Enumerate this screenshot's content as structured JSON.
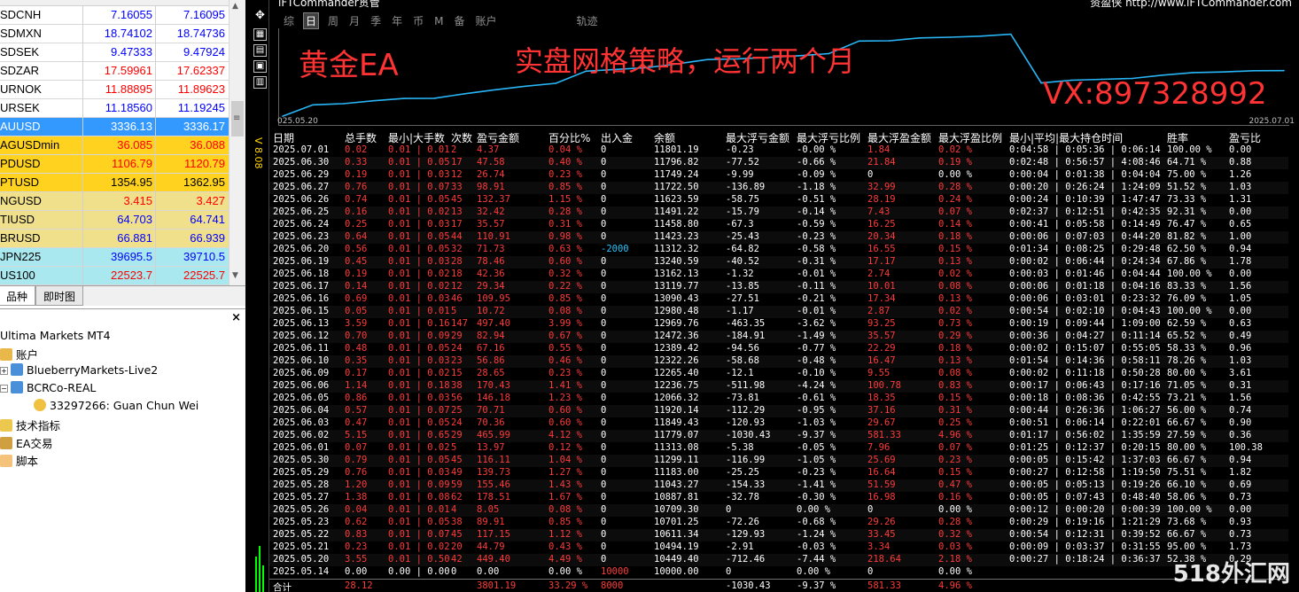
{
  "market_watch": {
    "rows": [
      {
        "sym": "SDCNH",
        "bid": "7.16055",
        "ask": "7.16095",
        "dir": "up",
        "bg": "#ffffff"
      },
      {
        "sym": "SDMXN",
        "bid": "18.74102",
        "ask": "18.74736",
        "dir": "up",
        "bg": "#ffffff"
      },
      {
        "sym": "SDSEK",
        "bid": "9.47333",
        "ask": "9.47924",
        "dir": "up",
        "bg": "#ffffff"
      },
      {
        "sym": "SDZAR",
        "bid": "17.59961",
        "ask": "17.62337",
        "dir": "dn",
        "bg": "#ffffff"
      },
      {
        "sym": "URNOK",
        "bid": "11.88895",
        "ask": "11.89623",
        "dir": "dn",
        "bg": "#ffffff"
      },
      {
        "sym": "URSEK",
        "bid": "11.18560",
        "ask": "11.19245",
        "dir": "up",
        "bg": "#ffffff"
      },
      {
        "sym": "AUUSD",
        "bid": "3336.13",
        "ask": "3336.17",
        "dir": "sel",
        "bg": "#3399ff"
      },
      {
        "sym": "AGUSDmin",
        "bid": "36.085",
        "ask": "36.088",
        "dir": "dn",
        "bg": "#ffd21f"
      },
      {
        "sym": "PDUSD",
        "bid": "1106.79",
        "ask": "1120.79",
        "dir": "dn",
        "bg": "#ffd21f"
      },
      {
        "sym": "PTUSD",
        "bid": "1354.95",
        "ask": "1362.95",
        "dir": "blk",
        "bg": "#ffd21f"
      },
      {
        "sym": "NGUSD",
        "bid": "3.415",
        "ask": "3.427",
        "dir": "dn",
        "bg": "#f0e08c"
      },
      {
        "sym": "TIUSD",
        "bid": "64.703",
        "ask": "64.741",
        "dir": "up",
        "bg": "#f0e08c"
      },
      {
        "sym": "BRUSD",
        "bid": "66.881",
        "ask": "66.939",
        "dir": "up",
        "bg": "#f0e08c"
      },
      {
        "sym": "JPN225",
        "bid": "39695.5",
        "ask": "39710.5",
        "dir": "up",
        "bg": "#a8e8ee"
      },
      {
        "sym": "US100",
        "bid": "22523.7",
        "ask": "22525.7",
        "dir": "dn",
        "bg": "#a8e8ee"
      }
    ],
    "tabs": [
      "品种",
      "即时图"
    ]
  },
  "navigator": {
    "root": "Ultima Markets MT4",
    "accounts": "账户",
    "server1": "BlueberryMarkets-Live2",
    "server2": "BCRCo-REAL",
    "user": "33297266: Guan Chun Wei",
    "indicators": "技术指标",
    "ea": "EA交易",
    "scripts": "脚本"
  },
  "side_label": "V 8.08",
  "app": {
    "title": "iFTCommander贯管",
    "link": "资盈侠 http://www.iFTCommander.com",
    "periods": [
      "综",
      "日",
      "周",
      "月",
      "季",
      "年",
      "币",
      "M",
      "备",
      "账户",
      "",
      "轨迹"
    ],
    "active_period": 1
  },
  "overlay": {
    "t1": "黄金EA",
    "t2": "实盘网格策略，运行两个月",
    "t3": "VX:897328992"
  },
  "chart_data": {
    "type": "line",
    "x_start_label": "025.05.20",
    "x_end_label": "2025.07.01",
    "color": "#29b6f6",
    "series": [
      {
        "x": [
          "2025.05.14",
          "2025.05.20",
          "2025.05.21",
          "2025.05.22",
          "2025.05.23",
          "2025.05.26",
          "2025.05.27",
          "2025.05.28",
          "2025.05.29",
          "2025.05.30",
          "2025.06.02",
          "2025.06.03",
          "2025.06.04",
          "2025.06.05",
          "2025.06.06",
          "2025.06.09",
          "2025.06.10",
          "2025.06.11",
          "2025.06.12",
          "2025.06.13",
          "2025.06.15",
          "2025.06.16",
          "2025.06.17",
          "2025.06.18",
          "2025.06.19",
          "2025.06.20",
          "2025.06.23",
          "2025.06.24",
          "2025.06.25",
          "2025.06.26",
          "2025.06.27",
          "2025.06.29",
          "2025.06.30",
          "2025.07.01"
        ],
        "values": [
          10000,
          10449.4,
          10494.19,
          10611.34,
          10701.25,
          10709.3,
          10887.81,
          11043.27,
          11183.0,
          11299.11,
          11779.07,
          11849.43,
          11920.14,
          12066.32,
          12236.75,
          12265.4,
          12322.26,
          12389.42,
          12472.36,
          12969.76,
          12980.48,
          13090.43,
          13119.77,
          13162.13,
          13240.59,
          11312.32,
          11423.23,
          11458.8,
          11491.22,
          11623.59,
          11722.5,
          11749.24,
          11796.82,
          11801.19
        ]
      }
    ]
  },
  "table": {
    "headers": [
      "日期",
      "总手数",
      "最小|大手数",
      "次数",
      "盈亏金额",
      "百分比%",
      "出入金",
      "余额",
      "最大浮亏金额",
      "最大浮亏比例",
      "最大浮盈金额",
      "最大浮盈比例",
      "最小|平均|最大持仓时间",
      "胜率",
      "盈亏比"
    ],
    "rows": [
      [
        "2025.07.01",
        "0.02",
        "0.01 | 0.01",
        "2",
        "4.37",
        "0.04 %",
        "0",
        "11801.19",
        "-0.23",
        "-0.00 %",
        "1.84",
        "0.02 %",
        "0:04:58 | 0:05:36 | 0:06:14",
        "100.00 %",
        "0.00"
      ],
      [
        "2025.06.30",
        "0.33",
        "0.01 | 0.05",
        "17",
        "47.58",
        "0.40 %",
        "0",
        "11796.82",
        "-77.52",
        "-0.66 %",
        "21.84",
        "0.19 %",
        "0:02:48 | 0:56:57 | 4:08:46",
        "64.71 %",
        "0.88"
      ],
      [
        "2025.06.29",
        "0.19",
        "0.01 | 0.03",
        "12",
        "26.74",
        "0.23 %",
        "0",
        "11749.24",
        "-9.99",
        "-0.09 %",
        "0",
        "0.00 %",
        "0:00:04 | 0:01:38 | 0:04:04",
        "75.00 %",
        "1.26"
      ],
      [
        "2025.06.27",
        "0.76",
        "0.01 | 0.07",
        "33",
        "98.91",
        "0.85 %",
        "0",
        "11722.50",
        "-136.89",
        "-1.18 %",
        "32.99",
        "0.28 %",
        "0:00:20 | 0:26:24 | 1:24:09",
        "51.52 %",
        "1.03"
      ],
      [
        "2025.06.26",
        "0.74",
        "0.01 | 0.05",
        "45",
        "132.37",
        "1.15 %",
        "0",
        "11623.59",
        "-58.75",
        "-0.51 %",
        "28.19",
        "0.24 %",
        "0:00:24 | 0:10:39 | 1:47:47",
        "73.33 %",
        "1.31"
      ],
      [
        "2025.06.25",
        "0.16",
        "0.01 | 0.02",
        "13",
        "32.42",
        "0.28 %",
        "0",
        "11491.22",
        "-15.79",
        "-0.14 %",
        "7.43",
        "0.07 %",
        "0:02:37 | 0:12:51 | 0:42:35",
        "92.31 %",
        "0.00"
      ],
      [
        "2025.06.24",
        "0.25",
        "0.01 | 0.03",
        "17",
        "35.57",
        "0.31 %",
        "0",
        "11458.80",
        "-67.3",
        "-0.59 %",
        "16.25",
        "0.14 %",
        "0:00:41 | 0:05:58 | 0:14:49",
        "76.47 %",
        "0.65"
      ],
      [
        "2025.06.23",
        "0.64",
        "0.01 | 0.05",
        "44",
        "110.91",
        "0.98 %",
        "0",
        "11423.23",
        "-25.43",
        "-0.23 %",
        "20.34",
        "0.18 %",
        "0:00:06 | 0:07:03 | 0:44:20",
        "81.82 %",
        "1.00"
      ],
      [
        "2025.06.20",
        "0.56",
        "0.01 | 0.05",
        "32",
        "71.73",
        "0.63 %",
        "-2000",
        "11312.32",
        "-64.82",
        "-0.58 %",
        "16.55",
        "0.15 %",
        "0:01:34 | 0:08:25 | 0:29:48",
        "62.50 %",
        "0.94"
      ],
      [
        "2025.06.19",
        "0.45",
        "0.01 | 0.03",
        "28",
        "78.46",
        "0.60 %",
        "0",
        "13240.59",
        "-40.52",
        "-0.31 %",
        "17.17",
        "0.13 %",
        "0:00:02 | 0:06:44 | 0:24:34",
        "67.86 %",
        "1.78"
      ],
      [
        "2025.06.18",
        "0.19",
        "0.01 | 0.02",
        "18",
        "42.36",
        "0.32 %",
        "0",
        "13162.13",
        "-1.32",
        "-0.01 %",
        "2.74",
        "0.02 %",
        "0:00:03 | 0:01:46 | 0:04:44",
        "100.00 %",
        "0.00"
      ],
      [
        "2025.06.17",
        "0.14",
        "0.01 | 0.02",
        "12",
        "29.34",
        "0.22 %",
        "0",
        "13119.77",
        "-13.85",
        "-0.11 %",
        "10.01",
        "0.08 %",
        "0:00:06 | 0:01:18 | 0:04:16",
        "83.33 %",
        "1.56"
      ],
      [
        "2025.06.16",
        "0.69",
        "0.01 | 0.03",
        "46",
        "109.95",
        "0.85 %",
        "0",
        "13090.43",
        "-27.51",
        "-0.21 %",
        "17.34",
        "0.13 %",
        "0:00:06 | 0:03:01 | 0:23:32",
        "76.09 %",
        "1.05"
      ],
      [
        "2025.06.15",
        "0.05",
        "0.01 | 0.01",
        "5",
        "10.72",
        "0.08 %",
        "0",
        "12980.48",
        "-1.17",
        "-0.01 %",
        "2.87",
        "0.02 %",
        "0:00:54 | 0:02:10 | 0:04:43",
        "100.00 %",
        "0.00"
      ],
      [
        "2025.06.13",
        "3.59",
        "0.01 | 0.16",
        "147",
        "497.40",
        "3.99 %",
        "0",
        "12969.76",
        "-463.35",
        "-3.62 %",
        "93.25",
        "0.73 %",
        "0:00:19 | 0:09:44 | 1:09:00",
        "62.59 %",
        "0.63"
      ],
      [
        "2025.06.12",
        "0.70",
        "0.01 | 0.09",
        "29",
        "82.94",
        "0.67 %",
        "0",
        "12472.36",
        "-184.91",
        "-1.49 %",
        "35.57",
        "0.29 %",
        "0:00:36 | 0:04:27 | 0:11:14",
        "65.52 %",
        "0.49"
      ],
      [
        "2025.06.11",
        "0.48",
        "0.01 | 0.05",
        "24",
        "67.16",
        "0.55 %",
        "0",
        "12389.42",
        "-94.56",
        "-0.77 %",
        "22.29",
        "0.18 %",
        "0:00:02 | 0:15:07 | 0:55:05",
        "58.33 %",
        "0.96"
      ],
      [
        "2025.06.10",
        "0.35",
        "0.01 | 0.03",
        "23",
        "56.86",
        "0.46 %",
        "0",
        "12322.26",
        "-58.68",
        "-0.48 %",
        "16.47",
        "0.13 %",
        "0:01:54 | 0:14:36 | 0:58:11",
        "78.26 %",
        "1.03"
      ],
      [
        "2025.06.09",
        "0.17",
        "0.01 | 0.02",
        "15",
        "28.65",
        "0.23 %",
        "0",
        "12265.40",
        "-12.1",
        "-0.10 %",
        "9.55",
        "0.08 %",
        "0:00:02 | 0:11:18 | 0:50:28",
        "80.00 %",
        "3.61"
      ],
      [
        "2025.06.06",
        "1.14",
        "0.01 | 0.18",
        "38",
        "170.43",
        "1.41 %",
        "0",
        "12236.75",
        "-511.98",
        "-4.24 %",
        "100.78",
        "0.83 %",
        "0:00:17 | 0:06:43 | 0:17:16",
        "71.05 %",
        "0.31"
      ],
      [
        "2025.06.05",
        "0.86",
        "0.01 | 0.03",
        "56",
        "146.18",
        "1.23 %",
        "0",
        "12066.32",
        "-73.81",
        "-0.61 %",
        "18.35",
        "0.15 %",
        "0:00:18 | 0:08:36 | 0:42:55",
        "73.21 %",
        "1.56"
      ],
      [
        "2025.06.04",
        "0.57",
        "0.01 | 0.07",
        "25",
        "70.71",
        "0.60 %",
        "0",
        "11920.14",
        "-112.29",
        "-0.95 %",
        "37.16",
        "0.31 %",
        "0:00:44 | 0:26:36 | 1:06:27",
        "56.00 %",
        "0.74"
      ],
      [
        "2025.06.03",
        "0.47",
        "0.01 | 0.05",
        "24",
        "70.36",
        "0.60 %",
        "0",
        "11849.43",
        "-120.93",
        "-1.03 %",
        "29.67",
        "0.25 %",
        "0:00:51 | 0:06:14 | 0:22:01",
        "66.67 %",
        "0.90"
      ],
      [
        "2025.06.02",
        "5.15",
        "0.01 | 0.65",
        "29",
        "465.99",
        "4.12 %",
        "0",
        "11779.07",
        "-1030.43",
        "-9.37 %",
        "581.33",
        "4.96 %",
        "0:01:17 | 0:56:02 | 1:35:59",
        "27.59 %",
        "0.36"
      ],
      [
        "2025.06.01",
        "0.07",
        "0.01 | 0.02",
        "5",
        "13.97",
        "0.12 %",
        "0",
        "11313.08",
        "-5.38",
        "-0.05 %",
        "7.96",
        "0.07 %",
        "0:01:25 | 0:12:37 | 0:20:15",
        "80.00 %",
        "100.38"
      ],
      [
        "2025.05.30",
        "0.79",
        "0.01 | 0.05",
        "45",
        "116.11",
        "1.04 %",
        "0",
        "11299.11",
        "-116.99",
        "-1.05 %",
        "25.69",
        "0.23 %",
        "0:00:05 | 0:15:42 | 1:37:03",
        "66.67 %",
        "0.94"
      ],
      [
        "2025.05.29",
        "0.76",
        "0.01 | 0.03",
        "49",
        "139.73",
        "1.27 %",
        "0",
        "11183.00",
        "-25.25",
        "-0.23 %",
        "16.64",
        "0.15 %",
        "0:00:27 | 0:12:58 | 1:19:50",
        "75.51 %",
        "1.82"
      ],
      [
        "2025.05.28",
        "1.20",
        "0.01 | 0.09",
        "59",
        "155.46",
        "1.43 %",
        "0",
        "11043.27",
        "-154.33",
        "-1.41 %",
        "51.59",
        "0.47 %",
        "0:00:05 | 0:05:13 | 0:19:26",
        "66.10 %",
        "0.69"
      ],
      [
        "2025.05.27",
        "1.38",
        "0.01 | 0.08",
        "62",
        "178.51",
        "1.67 %",
        "0",
        "10887.81",
        "-32.78",
        "-0.30 %",
        "16.98",
        "0.16 %",
        "0:00:05 | 0:07:43 | 0:48:40",
        "58.06 %",
        "0.73"
      ],
      [
        "2025.05.26",
        "0.04",
        "0.01 | 0.01",
        "4",
        "8.05",
        "0.08 %",
        "0",
        "10709.30",
        "0",
        "0.00 %",
        "0",
        "0.00 %",
        "0:00:12 | 0:00:20 | 0:00:39",
        "100.00 %",
        "0.00"
      ],
      [
        "2025.05.23",
        "0.62",
        "0.01 | 0.05",
        "38",
        "89.91",
        "0.85 %",
        "0",
        "10701.25",
        "-72.26",
        "-0.68 %",
        "29.26",
        "0.28 %",
        "0:00:29 | 0:19:16 | 1:21:29",
        "73.68 %",
        "0.93"
      ],
      [
        "2025.05.22",
        "0.83",
        "0.01 | 0.07",
        "45",
        "117.15",
        "1.12 %",
        "0",
        "10611.34",
        "-129.93",
        "-1.24 %",
        "33.45",
        "0.32 %",
        "0:00:54 | 0:12:31 | 0:39:52",
        "66.67 %",
        "0.73"
      ],
      [
        "2025.05.21",
        "0.23",
        "0.01 | 0.02",
        "20",
        "44.79",
        "0.43 %",
        "0",
        "10494.19",
        "-2.91",
        "-0.03 %",
        "3.34",
        "0.03 %",
        "0:00:09 | 0:03:37 | 0:31:55",
        "95.00 %",
        "1.73"
      ],
      [
        "2025.05.20",
        "3.55",
        "0.01 | 0.50",
        "42",
        "449.40",
        "4.49 %",
        "0",
        "10449.40",
        "-712.46",
        "-7.44 %",
        "218.64",
        "2.18 %",
        "0:00:27 | 0:18:24 | 0:36:37",
        "52.38 %",
        "0.29"
      ],
      [
        "2025.05.14",
        "0.00",
        "0.00 | 0.00",
        "0",
        "0.00",
        "0.00 %",
        "10000",
        "10000.00",
        "0",
        "0.00 %",
        "0",
        "0.00 %",
        "",
        "",
        ""
      ]
    ],
    "total": {
      "label": "合计",
      "lots": "28.12",
      "pl": "3801.19",
      "pct": "33.29 %",
      "inout": "8000",
      "maxdd": "-1030.43",
      "maxddp": "-9.37 %",
      "maxfp": "581.33",
      "maxfpp": "4.96 %"
    }
  },
  "watermark": "518外汇网"
}
